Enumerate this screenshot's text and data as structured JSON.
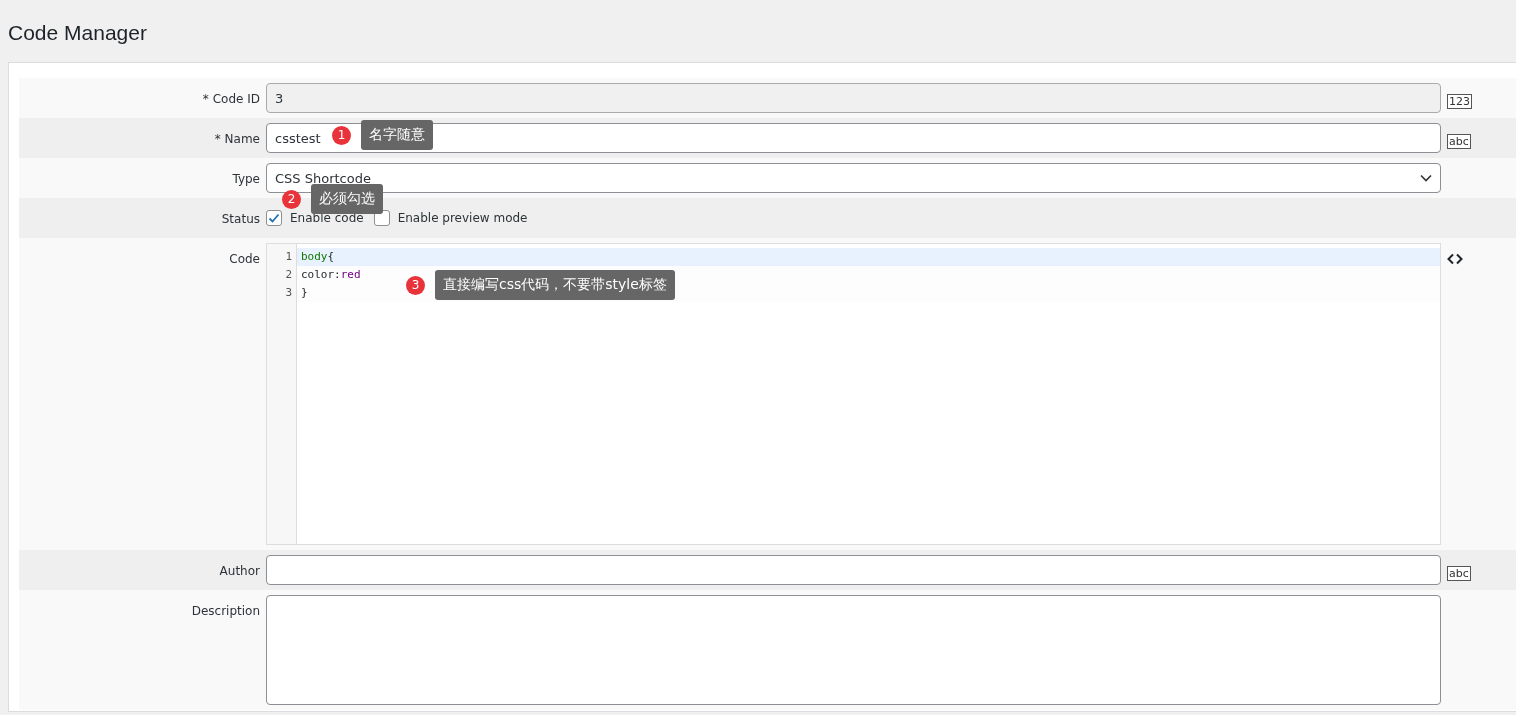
{
  "page_title": "Code Manager",
  "rows": [
    {
      "label": "* Code ID",
      "field": {
        "kind": "text",
        "value": "3",
        "disabled": true
      },
      "badge": "123"
    },
    {
      "label": "* Name",
      "field": {
        "kind": "text",
        "value": "csstest",
        "disabled": false
      },
      "badge": "abc",
      "callout": {
        "number": "1",
        "text": "名字随意"
      }
    },
    {
      "label": "Type",
      "field": {
        "kind": "select",
        "value": "CSS Shortcode"
      },
      "callout": {
        "number": "2",
        "text": "必须勾选"
      }
    },
    {
      "label": "Status",
      "field": {
        "kind": "checkboxes",
        "options": [
          {
            "label": "Enable code",
            "checked": true
          },
          {
            "label": "Enable preview mode",
            "checked": false
          }
        ]
      }
    },
    {
      "label": "Code",
      "field": {
        "kind": "code",
        "lines": [
          {
            "number": "1",
            "active": true,
            "tokens": [
              {
                "text": "body",
                "color": "#117700"
              },
              {
                "text": "{"
              }
            ]
          },
          {
            "number": "2",
            "active": false,
            "tokens": [
              {
                "text": "color:"
              },
              {
                "text": "red",
                "color": "#770088"
              }
            ]
          },
          {
            "number": "3",
            "active": false,
            "tokens": [
              {
                "text": "}"
              }
            ]
          }
        ]
      },
      "callout": {
        "number": "3",
        "text": "直接编写css代码，不要带style标签"
      }
    },
    {
      "label": "Author",
      "field": {
        "kind": "text",
        "disabled": false
      },
      "badge": "abc"
    },
    {
      "label": "Description",
      "field": {
        "kind": "textarea"
      }
    }
  ]
}
